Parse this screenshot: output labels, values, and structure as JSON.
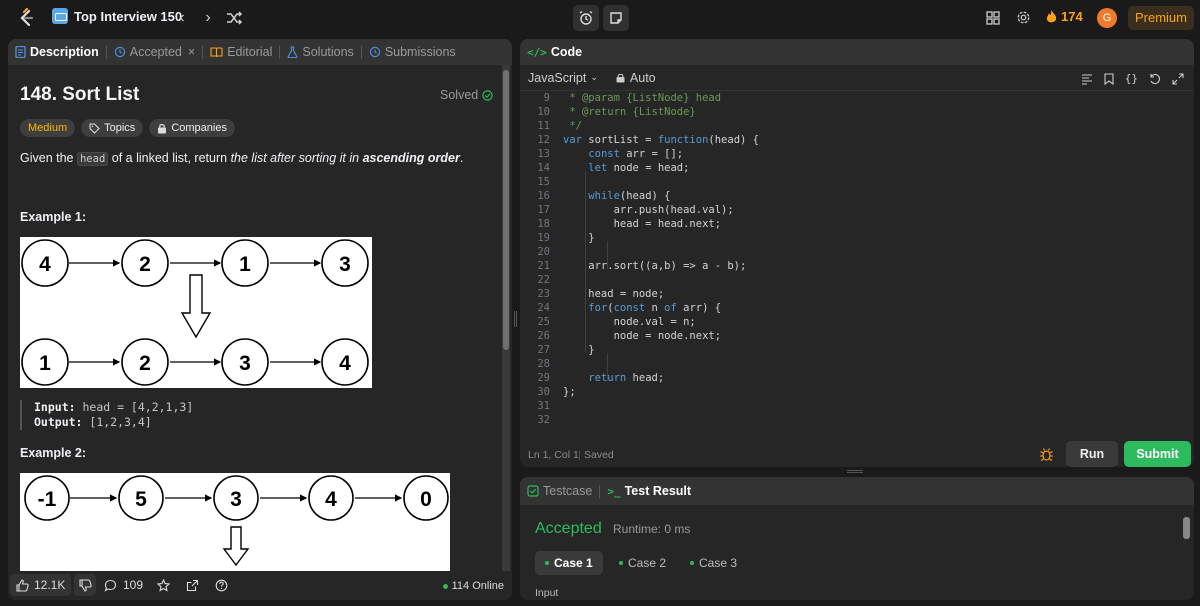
{
  "topbar": {
    "problem_list": "Top Interview 150",
    "streak": "174",
    "avatar_letter": "G",
    "premium": "Premium"
  },
  "desc_tabs": [
    {
      "label": "Description"
    },
    {
      "label": "Accepted"
    },
    {
      "label": "Editorial"
    },
    {
      "label": "Solutions"
    },
    {
      "label": "Submissions"
    }
  ],
  "problem": {
    "title": "148. Sort List",
    "solved": "Solved",
    "difficulty": "Medium",
    "topics": "Topics",
    "companies": "Companies",
    "desc_prefix": "Given the ",
    "desc_code": "head",
    "desc_mid": " of a linked list, return ",
    "desc_em": "the list after sorting it in ",
    "desc_strong": "ascending order",
    "desc_end": "."
  },
  "example1": {
    "title": "Example 1:",
    "input_label": "Input:",
    "input_value": " head = [4,2,1,3]",
    "output_label": "Output:",
    "output_value": " [1,2,3,4]",
    "top": [
      "4",
      "2",
      "1",
      "3"
    ],
    "bottom": [
      "1",
      "2",
      "3",
      "4"
    ]
  },
  "example2": {
    "title": "Example 2:",
    "top": [
      "-1",
      "5",
      "3",
      "4",
      "0"
    ]
  },
  "footer": {
    "likes": "12.1K",
    "comments": "109",
    "online": "114 Online"
  },
  "code": {
    "tab": "Code",
    "language": "JavaScript",
    "mode": "Auto",
    "status_pos": "Ln 1, Col 1",
    "status_saved": "Saved",
    "run": "Run",
    "submit": "Submit",
    "lines": [
      {
        "n": "9",
        "t": " * @param {ListNode} head"
      },
      {
        "n": "10",
        "t": " * @return {ListNode}"
      },
      {
        "n": "11",
        "t": " */"
      },
      {
        "n": "12",
        "t": "var sortList = function(head) {"
      },
      {
        "n": "13",
        "t": "    const arr = [];"
      },
      {
        "n": "14",
        "t": "    let node = head;"
      },
      {
        "n": "15",
        "t": ""
      },
      {
        "n": "16",
        "t": "    while(head) {"
      },
      {
        "n": "17",
        "t": "        arr.push(head.val);"
      },
      {
        "n": "18",
        "t": "        head = head.next;"
      },
      {
        "n": "19",
        "t": "    }"
      },
      {
        "n": "20",
        "t": ""
      },
      {
        "n": "21",
        "t": "    arr.sort((a,b) => a - b);"
      },
      {
        "n": "22",
        "t": ""
      },
      {
        "n": "23",
        "t": "    head = node;"
      },
      {
        "n": "24",
        "t": "    for(const n of arr) {"
      },
      {
        "n": "25",
        "t": "        node.val = n;"
      },
      {
        "n": "26",
        "t": "        node = node.next;"
      },
      {
        "n": "27",
        "t": "    }"
      },
      {
        "n": "28",
        "t": ""
      },
      {
        "n": "29",
        "t": "    return head;"
      },
      {
        "n": "30",
        "t": "};"
      },
      {
        "n": "31",
        "t": ""
      },
      {
        "n": "32",
        "t": ""
      }
    ]
  },
  "test": {
    "testcase": "Testcase",
    "result": "Test Result",
    "status": "Accepted",
    "runtime": "Runtime: 0 ms",
    "cases": [
      "Case 1",
      "Case 2",
      "Case 3"
    ],
    "input_label": "Input"
  },
  "colors": {
    "accent_green": "#2cbb5d",
    "medium": "#ffb800",
    "premium": "#ffa116"
  }
}
